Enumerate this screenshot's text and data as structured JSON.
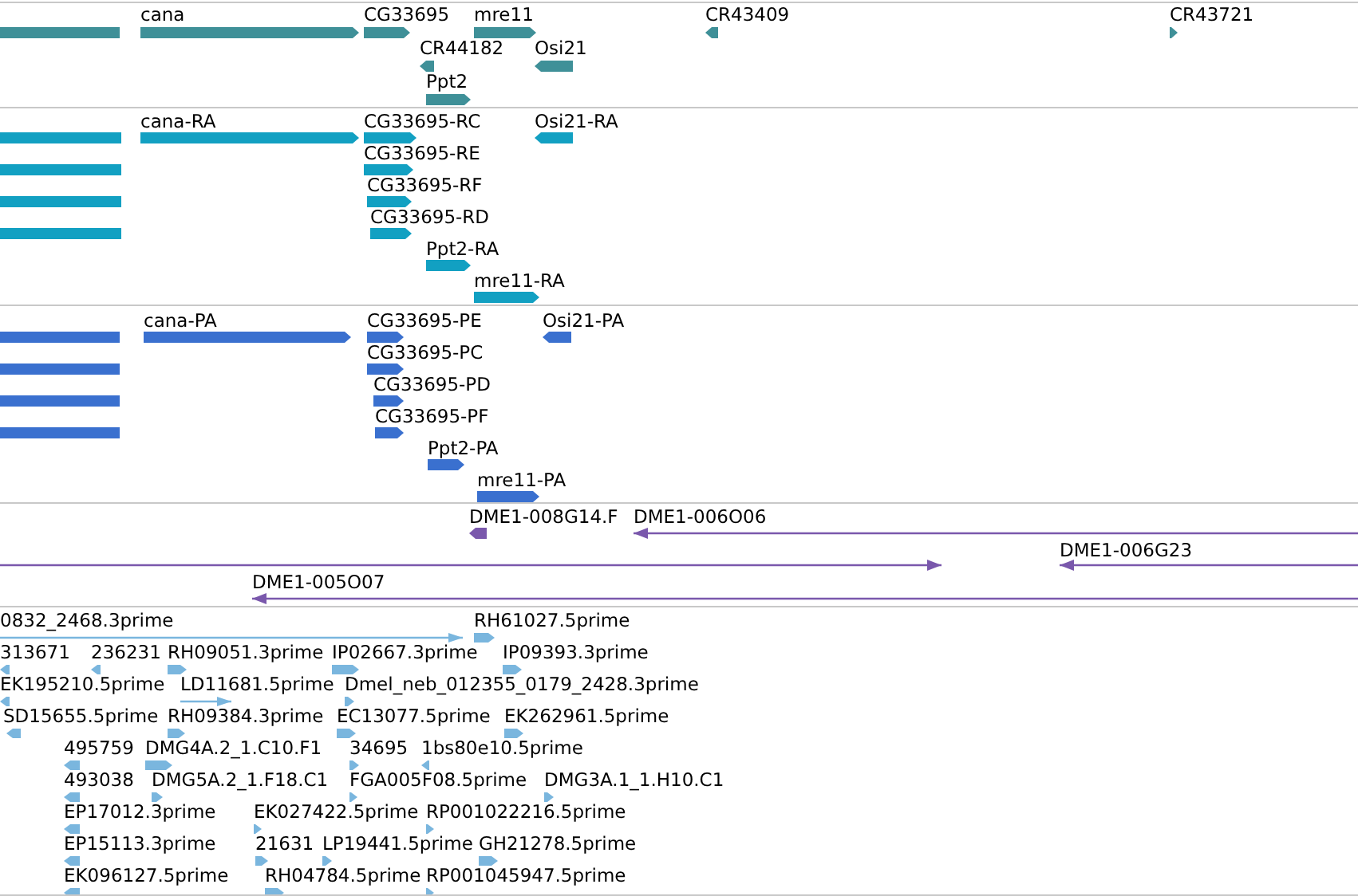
{
  "tracks": [
    {
      "kind": "gene",
      "color": "#3f9098",
      "features": [
        {
          "reverse": true
        },
        {
          "label": "cana",
          "reverse": false
        },
        {
          "label": "CG33695",
          "reverse": false
        },
        {
          "label": "mre11",
          "reverse": false
        },
        {
          "label": "CR43409",
          "reverse": true
        },
        {
          "label": "CR43721",
          "reverse": false
        },
        {
          "label": "CR44182",
          "reverse": true
        },
        {
          "label": "Osi21",
          "reverse": true
        },
        {
          "label": "Ppt2",
          "reverse": false
        }
      ]
    },
    {
      "kind": "transcript",
      "color": "#12a0c2",
      "features": [
        {
          "reverse": true
        },
        {
          "label": "cana-RA",
          "reverse": false
        },
        {
          "label": "CG33695-RC",
          "reverse": false
        },
        {
          "label": "Osi21-RA",
          "reverse": true
        },
        {
          "reverse": true
        },
        {
          "label": "CG33695-RE",
          "reverse": false
        },
        {
          "reverse": true
        },
        {
          "label": "CG33695-RF",
          "reverse": false
        },
        {
          "reverse": true
        },
        {
          "label": "CG33695-RD",
          "reverse": false
        },
        {
          "label": "Ppt2-RA",
          "reverse": false
        },
        {
          "label": "mre11-RA",
          "reverse": false
        }
      ]
    },
    {
      "kind": "protein",
      "color": "#3a70cf",
      "features": [
        {
          "reverse": true
        },
        {
          "label": "cana-PA",
          "reverse": false
        },
        {
          "label": "CG33695-PE",
          "reverse": false
        },
        {
          "label": "Osi21-PA",
          "reverse": true
        },
        {
          "reverse": true
        },
        {
          "label": "CG33695-PC",
          "reverse": false
        },
        {
          "reverse": true
        },
        {
          "label": "CG33695-PD",
          "reverse": false
        },
        {
          "reverse": true
        },
        {
          "label": "CG33695-PF",
          "reverse": false
        },
        {
          "label": "Ppt2-PA",
          "reverse": false
        },
        {
          "label": "mre11-PA",
          "reverse": false
        }
      ]
    },
    {
      "kind": "clone",
      "color": "#7a58ac",
      "features": [
        {
          "label": "DME1-008G14.F",
          "reverse": true
        },
        {
          "label": "DME1-006O06",
          "reverse": true
        },
        {
          "reverse": false
        },
        {
          "label": "DME1-006G23",
          "reverse": true
        },
        {
          "label": "DME1-005O07",
          "reverse": true
        }
      ]
    },
    {
      "kind": "est",
      "color": "#7ab6de",
      "features": [
        {
          "label": "0832_2468.3prime",
          "reverse": false
        },
        {
          "label": "RH61027.5prime",
          "reverse": false
        },
        {
          "label": "313671",
          "reverse": true
        },
        {
          "label": "236231",
          "reverse": true
        },
        {
          "label": "RH09051.3prime",
          "reverse": false
        },
        {
          "label": "IP02667.3prime",
          "reverse": false
        },
        {
          "label": "IP09393.3prime",
          "reverse": false
        },
        {
          "label": "EK195210.5prime",
          "reverse": true
        },
        {
          "label": "LD11681.5prime",
          "reverse": false
        },
        {
          "label": "Dmel_neb_012355_0179_2428.3prime",
          "reverse": false
        },
        {
          "label": "SD15655.5prime",
          "reverse": true
        },
        {
          "label": "RH09384.3prime",
          "reverse": false
        },
        {
          "label": "EC13077.5prime",
          "reverse": false
        },
        {
          "label": "EK262961.5prime",
          "reverse": false
        },
        {
          "label": "495759",
          "reverse": true
        },
        {
          "label": "DMG4A.2_1.C10.F1",
          "reverse": false
        },
        {
          "label": "34695",
          "reverse": false
        },
        {
          "label": "1bs80e10.5prime",
          "reverse": true
        },
        {
          "label": "493038",
          "reverse": true
        },
        {
          "label": "DMG5A.2_1.F18.C1",
          "reverse": false
        },
        {
          "label": "FGA005F08.5prime",
          "reverse": false
        },
        {
          "label": "DMG3A.1_1.H10.C1",
          "reverse": false
        },
        {
          "label": "EP17012.3prime",
          "reverse": true
        },
        {
          "label": "EK027422.5prime",
          "reverse": false
        },
        {
          "label": "RP001022216.5prime",
          "reverse": false
        },
        {
          "label": "EP15113.3prime",
          "reverse": true
        },
        {
          "label": "21631",
          "reverse": false
        },
        {
          "label": "LP19441.5prime",
          "reverse": false
        },
        {
          "label": "GH21278.5prime",
          "reverse": false
        },
        {
          "label": "EK096127.5prime",
          "reverse": true
        },
        {
          "label": "RH04784.5prime",
          "reverse": false
        },
        {
          "label": "RP001045947.5prime",
          "reverse": false
        }
      ]
    }
  ]
}
